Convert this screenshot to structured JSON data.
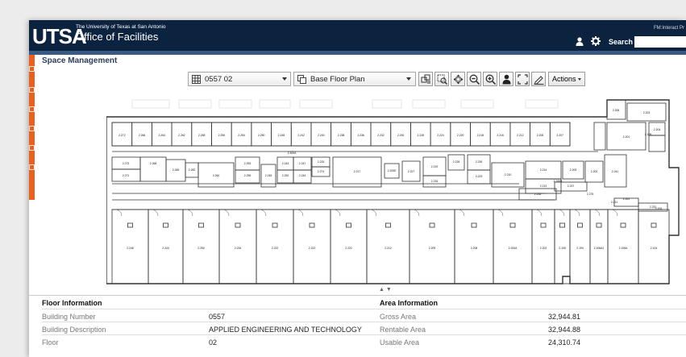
{
  "header": {
    "logo": "UTSA",
    "org_line": "The University of Texas at San Antonio",
    "title": "Office of Facilities",
    "product": "FM:Interact Pr",
    "search_label": "Search",
    "search_value": ""
  },
  "page": {
    "title": "Space Management"
  },
  "toolbar": {
    "floor_select": "0557 02",
    "layer_select": "Base Floor Plan",
    "actions_label": "Actions",
    "buttons": [
      "layers-button",
      "select-region-button",
      "pan-button",
      "zoom-out-button",
      "zoom-in-button",
      "user-button",
      "fullscreen-button",
      "markup-button"
    ]
  },
  "rooms": {
    "top_row": [
      "2.272",
      "2.266",
      "2.264",
      "2.262",
      "2.258",
      "2.256",
      "2.254",
      "2.250",
      "2.248",
      "2.242",
      "2.240",
      "2.238",
      "2.236",
      "2.232",
      "2.230",
      "2.228",
      "2.224",
      "2.220",
      "2.218",
      "2.216",
      "2.212",
      "2.208",
      "2.207",
      "2.206",
      "2.203",
      "2.204",
      "2.201"
    ],
    "mid": [
      "2.300A",
      "2.273",
      "2.271",
      "2.268",
      "2.265",
      "2.282",
      "2.260",
      "2.253",
      "2.255",
      "2.245",
      "2.243",
      "2.252",
      "2.247",
      "2.244",
      "2.233",
      "2.274",
      "2.217",
      "2.200E",
      "2.227",
      "2.219",
      "2.215",
      "2.228",
      "2.226",
      "2.223",
      "2.210",
      "2.214",
      "2.213",
      "2.209",
      "2.202",
      "2.241",
      "2.237",
      "2.235",
      "2.261",
      "2.231",
      "2.211",
      "2.200B",
      "2.275",
      "2.205",
      "2.153"
    ],
    "bottom": [
      "2.246",
      "2.244",
      "2.250",
      "2.234",
      "2.222",
      "2.222",
      "2.222",
      "2.212",
      "2.209",
      "2.208",
      "2.200A",
      "2.202",
      "2.105",
      "2.194",
      "2.106A1",
      "2.106A",
      "2.104"
    ]
  },
  "floor_info": {
    "title": "Floor Information",
    "rows": [
      {
        "label": "Building Number",
        "value": "0557"
      },
      {
        "label": "Building Description",
        "value": "APPLIED ENGINEERING AND TECHNOLOGY"
      },
      {
        "label": "Floor",
        "value": "02"
      }
    ]
  },
  "area_info": {
    "title": "Area Information",
    "rows": [
      {
        "label": "Gross Area",
        "value": "32,944.81"
      },
      {
        "label": "Rentable Area",
        "value": "32,944.88"
      },
      {
        "label": "Usable Area",
        "value": "24,310.74"
      }
    ]
  },
  "colors": {
    "header": "#0c2340",
    "accent": "#e8601c",
    "strip": "#3a5a85"
  }
}
